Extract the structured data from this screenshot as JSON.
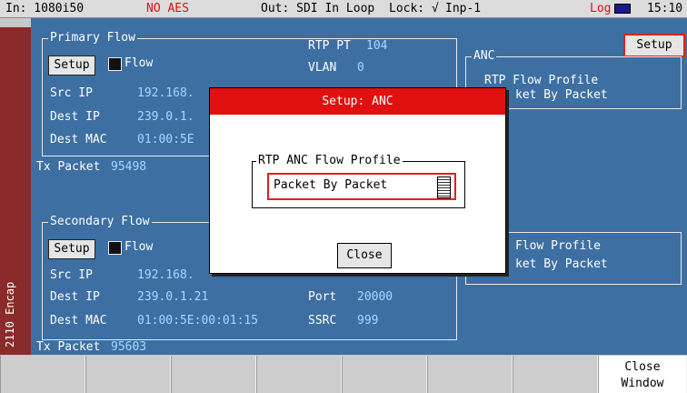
{
  "status_bar": {
    "input": "In: 1080i50",
    "aes": "NO AES",
    "output": "Out: SDI In Loop",
    "lock": "Lock: √",
    "inp": "Inp-1",
    "log": "Log",
    "time": "15:10"
  },
  "side_tab": {
    "label": "2110 Encap"
  },
  "top_setup_button": "Setup",
  "primary_flow": {
    "legend": "Primary Flow",
    "setup_label": "Setup",
    "flow_label": "Flow",
    "src_ip_label": "Src IP",
    "src_ip_value": "192.168.",
    "dest_ip_label": "Dest IP",
    "dest_ip_value": "239.0.1.",
    "dest_mac_label": "Dest MAC",
    "dest_mac_value": "01:00:5E",
    "rtp_pt_label": "RTP PT",
    "rtp_pt_value": "104",
    "vlan_label": "VLAN",
    "vlan_value": "0",
    "tx_packet_label": "Tx Packet",
    "tx_packet_value": "95498"
  },
  "anc_panel": {
    "legend": "ANC",
    "profile_label": "RTP Flow Profile",
    "profile_value": "ket By Packet"
  },
  "secondary_flow": {
    "legend": "Secondary Flow",
    "setup_label": "Setup",
    "flow_label": "Flow",
    "src_ip_label": "Src IP",
    "src_ip_value": "192.168.",
    "dest_ip_label": "Dest IP",
    "dest_ip_value": "239.0.1.21",
    "dest_mac_label": "Dest MAC",
    "dest_mac_value": "01:00:5E:00:01:15",
    "port_label": "Port",
    "port_value": "20000",
    "ssrc_label": "SSRC",
    "ssrc_value": "999",
    "tx_packet_label": "Tx Packet",
    "tx_packet_value": "95603",
    "profile_label": "Flow Profile",
    "profile_value": "ket By Packet"
  },
  "modal": {
    "title": "Setup: ANC",
    "group_legend": "RTP ANC Flow Profile",
    "select_value": "Packet By Packet",
    "close_label": "Close"
  },
  "footer": {
    "last_button": "Close\nWindow"
  }
}
